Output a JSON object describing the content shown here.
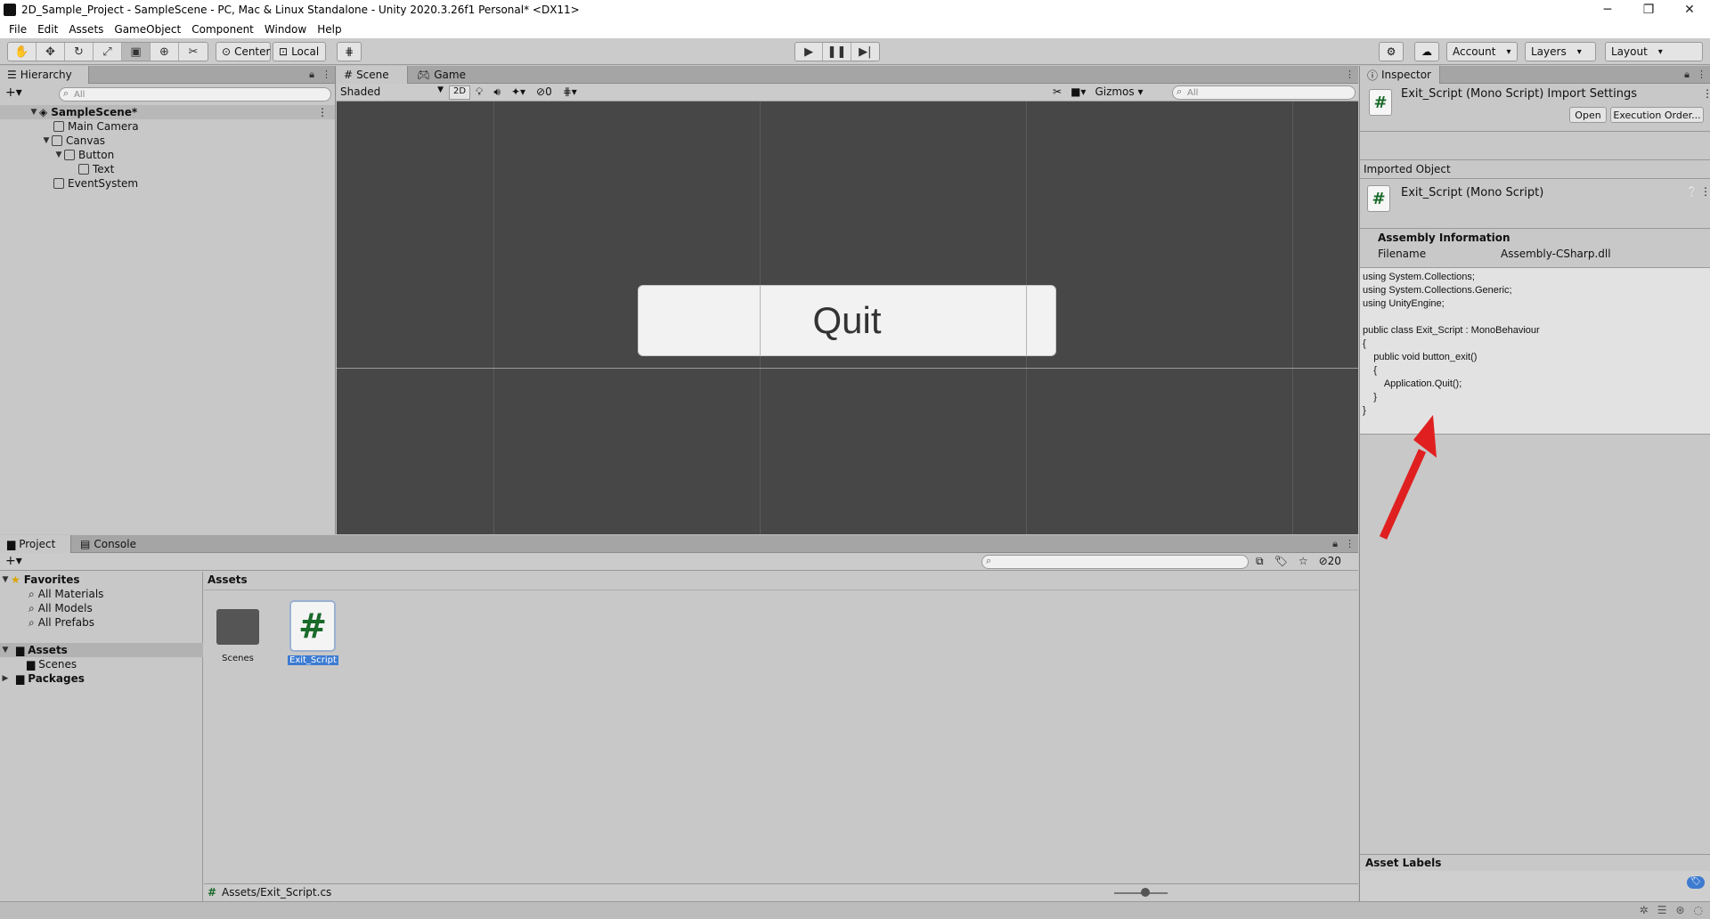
{
  "window": {
    "title": "2D_Sample_Project - SampleScene - PC, Mac & Linux Standalone - Unity 2020.3.26f1 Personal* <DX11>",
    "controls": [
      "─",
      "❐",
      "✕"
    ]
  },
  "menubar": [
    "File",
    "Edit",
    "Assets",
    "GameObject",
    "Component",
    "Window",
    "Help"
  ],
  "toolbar": {
    "tools": [
      "hand-icon",
      "move-icon",
      "rotate-icon",
      "scale-icon",
      "rect-icon",
      "transform-icon",
      "custom-tool-icon"
    ],
    "pivot": "Center",
    "space": "Local",
    "account": "Account",
    "layers": "Layers",
    "layout": "Layout"
  },
  "hierarchy": {
    "tab": "Hierarchy",
    "search_placeholder": "All",
    "items": [
      {
        "label": "SampleScene*",
        "depth": 0,
        "expanded": true
      },
      {
        "label": "Main Camera",
        "depth": 1
      },
      {
        "label": "Canvas",
        "depth": 1,
        "expanded": true
      },
      {
        "label": "Button",
        "depth": 2,
        "expanded": true
      },
      {
        "label": "Text",
        "depth": 3
      },
      {
        "label": "EventSystem",
        "depth": 1
      }
    ]
  },
  "scene": {
    "tabs": [
      "Scene",
      "Game"
    ],
    "shading": "Shaded",
    "mode_2d": "2D",
    "hidden_count": "0",
    "gizmos": "Gizmos",
    "search_placeholder": "All",
    "button_text": "Quit"
  },
  "inspector": {
    "tab": "Inspector",
    "header_title": "Exit_Script (Mono Script) Import Settings",
    "open_label": "Open",
    "exec_order_label": "Execution Order...",
    "imported_object_label": "Imported Object",
    "object_title": "Exit_Script (Mono Script)",
    "assembly_info_label": "Assembly Information",
    "filename_key": "Filename",
    "filename_value": "Assembly-CSharp.dll",
    "code": "using System.Collections;\nusing System.Collections.Generic;\nusing UnityEngine;\n\npublic class Exit_Script : MonoBehaviour\n{\n    public void button_exit()\n    {\n        Application.Quit();\n    }\n}",
    "asset_labels": "Asset Labels"
  },
  "project": {
    "tabs": [
      "Project",
      "Console"
    ],
    "favorites_label": "Favorites",
    "favorites": [
      "All Materials",
      "All Models",
      "All Prefabs"
    ],
    "assets_label": "Assets",
    "assets_children": [
      "Scenes"
    ],
    "packages_label": "Packages",
    "breadcrumb": "Assets",
    "items": [
      {
        "label": "Scenes",
        "type": "folder"
      },
      {
        "label": "Exit_Script",
        "type": "script",
        "selected": true
      }
    ],
    "path": "Assets/Exit_Script.cs",
    "hidden_count": "20"
  },
  "colors": {
    "accent_selection": "#3d7bd1",
    "arrow": "#e02020",
    "script_green": "#1a6a2a"
  }
}
